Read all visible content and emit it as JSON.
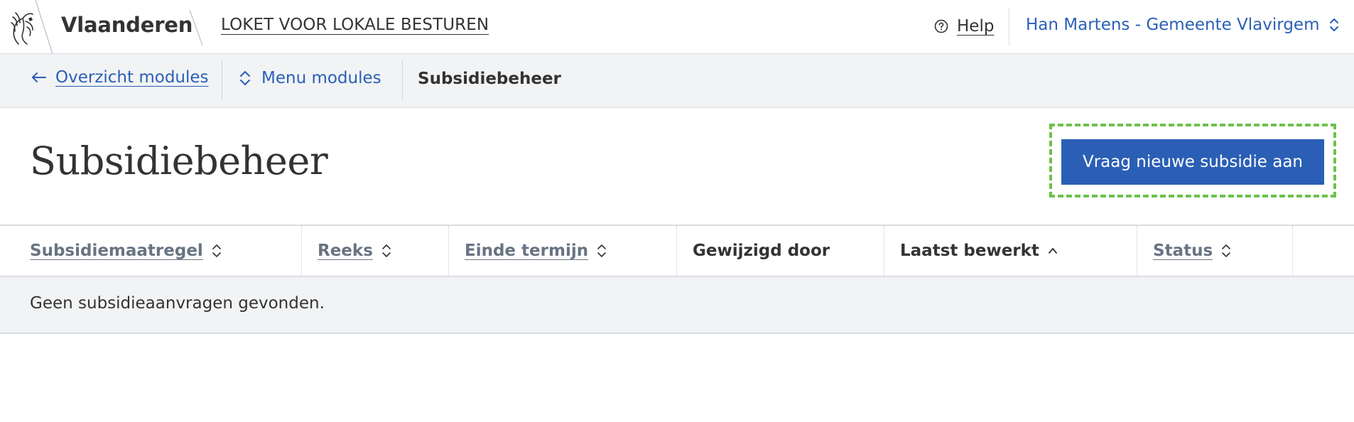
{
  "header": {
    "brand": "Vlaanderen",
    "app_title": "LOKET VOOR LOKALE BESTUREN",
    "help_label": "Help",
    "user_label": "Han Martens - Gemeente Vlavirgem"
  },
  "subnav": {
    "back_label": "Overzicht modules",
    "menu_label": "Menu modules",
    "current_label": "Subsidiebeheer"
  },
  "page": {
    "title": "Subsidiebeheer",
    "primary_button_label": "Vraag nieuwe subsidie aan"
  },
  "table": {
    "columns": [
      {
        "label": "Subsidiemaatregel",
        "sortable": true,
        "sort_state": "none"
      },
      {
        "label": "Reeks",
        "sortable": true,
        "sort_state": "none"
      },
      {
        "label": "Einde termijn",
        "sortable": true,
        "sort_state": "none"
      },
      {
        "label": "Gewijzigd door",
        "sortable": false,
        "sort_state": "none"
      },
      {
        "label": "Laatst bewerkt",
        "sortable": true,
        "sort_state": "ascending"
      },
      {
        "label": "Status",
        "sortable": true,
        "sort_state": "none"
      },
      {
        "label": "",
        "sortable": false,
        "sort_state": "none"
      }
    ],
    "empty_message": "Geen subsidieaanvragen gevonden."
  },
  "colors": {
    "link_blue": "#2a5fb5",
    "primary_button": "#2a5fb5",
    "subnav_bg": "#f1f3f5",
    "highlight_dashed": "#6cc24a",
    "text_dark": "#333332",
    "sortable_header": "#687483"
  },
  "icons": {
    "logo": "flanders-lion-logo",
    "help": "help-circle-icon",
    "user_switch": "chevron-up-down-icon",
    "back": "arrow-left-icon",
    "menu": "chevron-up-down-icon",
    "sort_none": "sort-up-down-icon",
    "sort_asc": "sort-ascending-icon"
  }
}
